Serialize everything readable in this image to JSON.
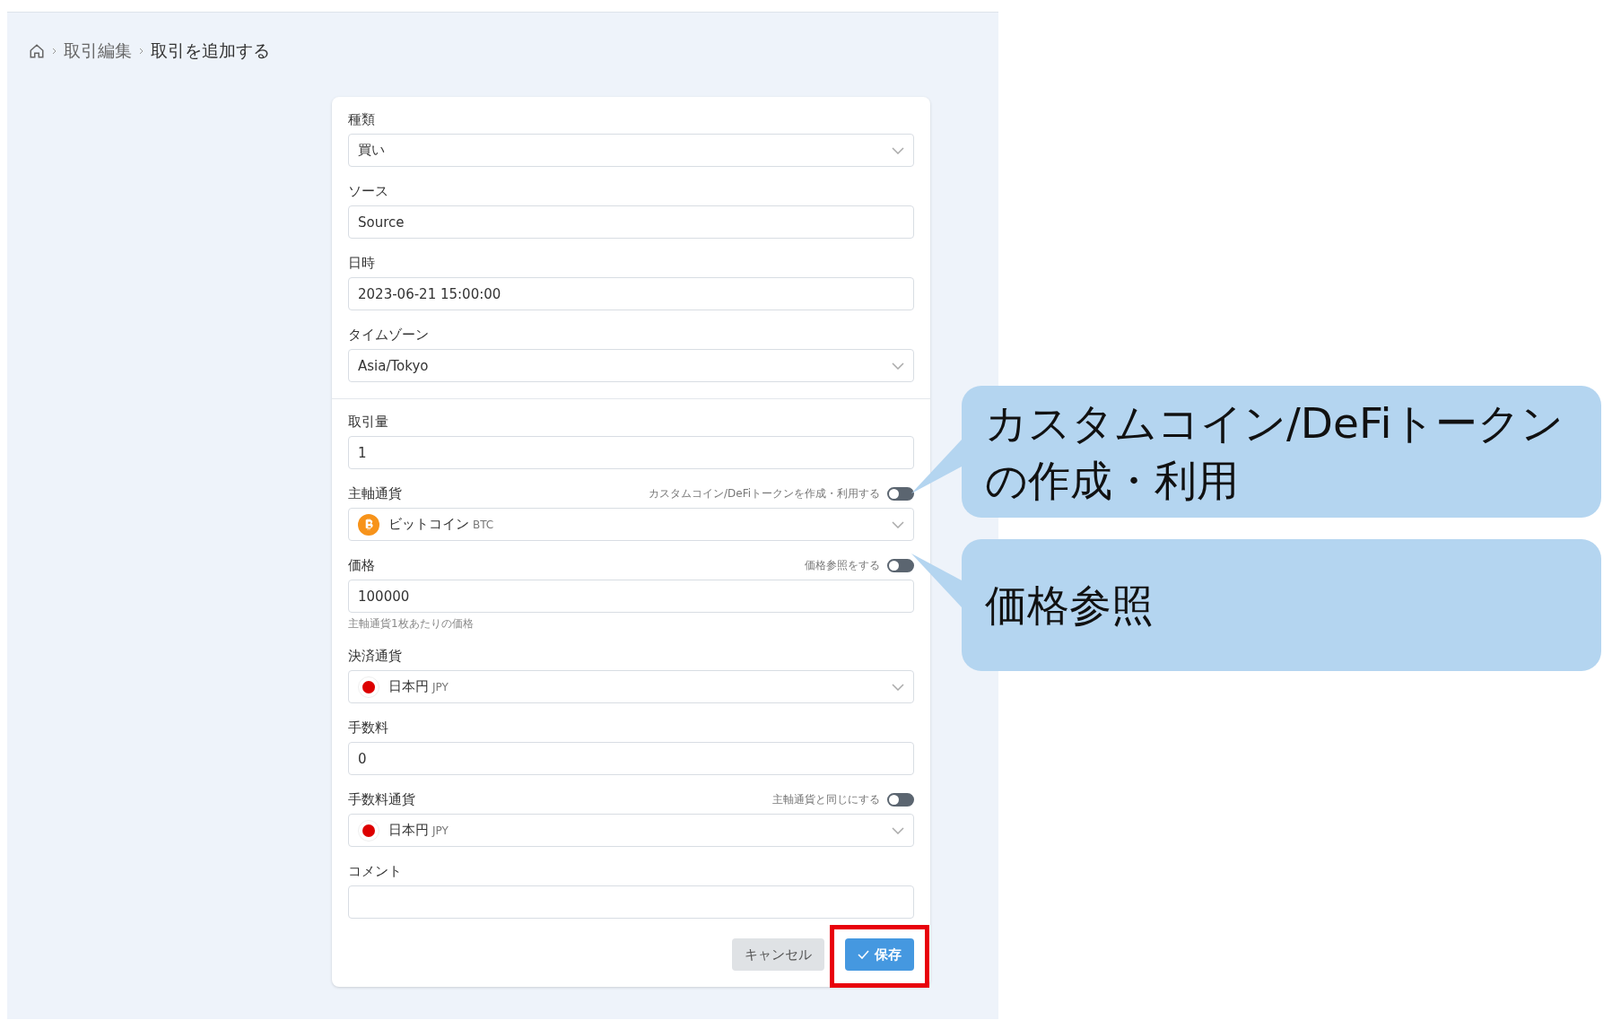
{
  "breadcrumb": {
    "items": [
      {
        "label": "取引編集",
        "current": false
      },
      {
        "label": "取引を追加する",
        "current": true
      }
    ]
  },
  "sections": [
    {
      "fields": [
        {
          "kind": "select",
          "label": "種類",
          "value": "買い"
        },
        {
          "kind": "input",
          "label": "ソース",
          "value": "Source"
        },
        {
          "kind": "input",
          "label": "日時",
          "value": "2023-06-21 15:00:00"
        },
        {
          "kind": "select",
          "label": "タイムゾーン",
          "value": "Asia/Tokyo"
        }
      ]
    },
    {
      "fields": [
        {
          "kind": "input",
          "label": "取引量",
          "value": "1"
        },
        {
          "kind": "currency",
          "label": "主軸通貨",
          "toggle": {
            "label": "カスタムコイン/DeFiトークンを作成・利用する",
            "on": false
          },
          "currency": {
            "kind": "bitcoin",
            "name": "ビットコイン",
            "code": "BTC"
          }
        },
        {
          "kind": "input",
          "label": "価格",
          "toggle": {
            "label": "価格参照をする",
            "on": false
          },
          "value": "100000",
          "help": "主軸通貨1枚あたりの価格"
        },
        {
          "kind": "currency",
          "label": "決済通貨",
          "currency": {
            "kind": "yen",
            "name": "日本円",
            "code": "JPY"
          }
        },
        {
          "kind": "input",
          "label": "手数料",
          "value": "0"
        },
        {
          "kind": "currency",
          "label": "手数料通貨",
          "toggle": {
            "label": "主軸通貨と同じにする",
            "on": false
          },
          "currency": {
            "kind": "yen",
            "name": "日本円",
            "code": "JPY"
          }
        },
        {
          "kind": "input",
          "label": "コメント"
        }
      ]
    }
  ],
  "buttons": [
    {
      "kind": "cancel",
      "label": "キャンセル",
      "highlighted": false
    },
    {
      "kind": "save",
      "label": "保存",
      "highlighted": true
    }
  ],
  "callouts": [
    {
      "text": "カスタムコイン/DeFiトークンの作成・利用"
    },
    {
      "text": "価格参照"
    }
  ]
}
